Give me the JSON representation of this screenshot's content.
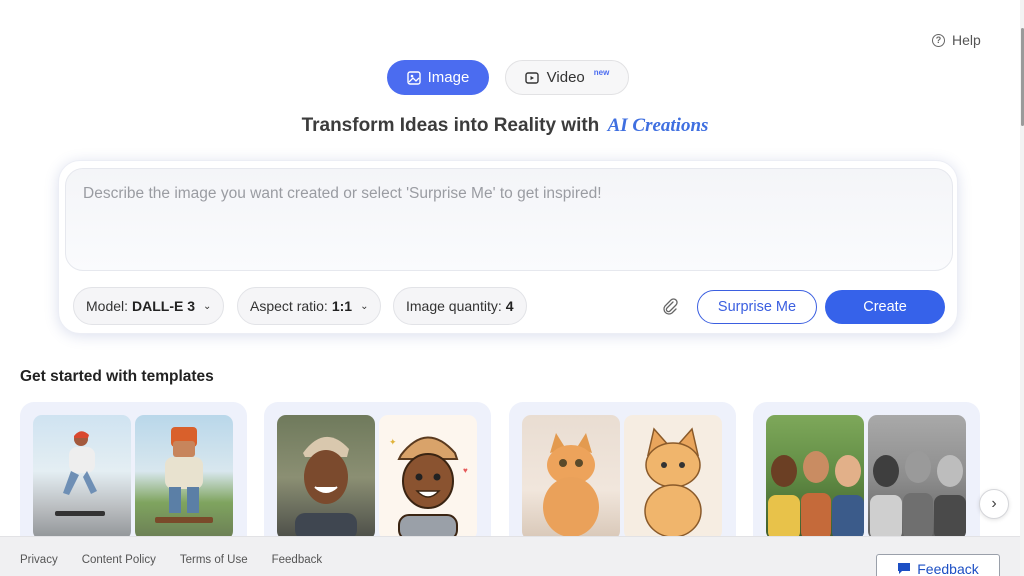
{
  "header": {
    "help_label": "Help"
  },
  "mode_tabs": [
    {
      "label": "Image",
      "active": true,
      "icon": "image-icon"
    },
    {
      "label": "Video",
      "active": false,
      "icon": "video-icon",
      "badge": "new"
    }
  ],
  "headline": {
    "text": "Transform Ideas into Reality with",
    "accent": "AI Creations"
  },
  "prompt": {
    "placeholder": "Describe the image you want created or select 'Surprise Me' to get inspired!",
    "value": ""
  },
  "options": {
    "model": {
      "label": "Model:",
      "value": "DALL-E 3"
    },
    "aspect": {
      "label": "Aspect ratio:",
      "value": "1:1"
    },
    "quantity": {
      "label": "Image quantity:",
      "value": "4"
    }
  },
  "actions": {
    "surprise_label": "Surprise Me",
    "create_label": "Create",
    "attach_icon": "paperclip-icon"
  },
  "templates": {
    "title": "Get started with templates"
  },
  "footer": {
    "links": [
      "Privacy",
      "Content Policy",
      "Terms of Use",
      "Feedback"
    ],
    "feedback_button": "Feedback"
  },
  "colors": {
    "accent": "#4b6cf0",
    "create": "#3662ea",
    "card_bg": "#eef1fb"
  }
}
